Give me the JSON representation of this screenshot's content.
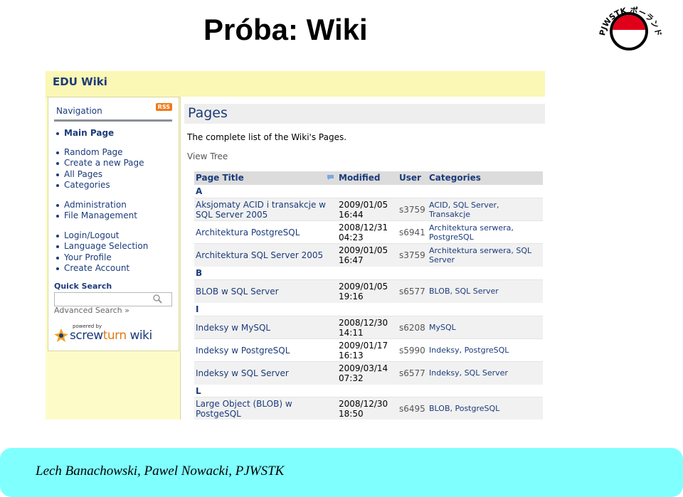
{
  "slide": {
    "title": "Próba: Wiki",
    "footer": "Lech Banachowski, Pawel Nowacki, PJWSTK"
  },
  "logo": {
    "text": "PJWSTK ポーランド日本情報工科大学",
    "colors": {
      "ring": "#000000",
      "disk": "#e0001a"
    }
  },
  "wiki": {
    "site_title": "EDU Wiki",
    "navigation": {
      "header": "Navigation",
      "rss_label": "RSS",
      "items": [
        {
          "label": "Main Page"
        },
        {
          "label": "Random Page"
        },
        {
          "label": "Create a new Page"
        },
        {
          "label": "All Pages"
        },
        {
          "label": "Categories"
        },
        {
          "label": "Administration"
        },
        {
          "label": "File Management"
        },
        {
          "label": "Login/Logout"
        },
        {
          "label": "Language Selection"
        },
        {
          "label": "Your Profile"
        },
        {
          "label": "Create Account"
        }
      ]
    },
    "quick_search": {
      "label": "Quick Search",
      "value": "",
      "advanced_link": "Advanced Search »"
    },
    "powered_by": {
      "small_text": "powered by",
      "brand_1": "screw",
      "brand_2": "turn",
      "brand_3": " wiki"
    },
    "pages": {
      "title": "Pages",
      "intro": "The complete list of the Wiki's Pages.",
      "view_tree": "View Tree",
      "columns": {
        "title": "Page Title",
        "modified": "Modified",
        "user": "User",
        "categories": "Categories"
      },
      "groups": [
        {
          "letter": "A",
          "rows": [
            {
              "title": "Aksjomaty ACID i transakcje w SQL Server 2005",
              "modified": "2009/01/05 16:44",
              "user": "s3759",
              "categories": "ACID, SQL Server, Transakcje"
            },
            {
              "title": "Architektura PostgreSQL",
              "modified": "2008/12/31 04:23",
              "user": "s6941",
              "categories": "Architektura serwera, PostgreSQL"
            },
            {
              "title": "Architektura SQL Server 2005",
              "modified": "2009/01/05 16:47",
              "user": "s3759",
              "categories": "Architektura serwera, SQL Server"
            }
          ]
        },
        {
          "letter": "B",
          "rows": [
            {
              "title": "BLOB w SQL Server",
              "modified": "2009/01/05 19:16",
              "user": "s6577",
              "categories": "BLOB, SQL Server"
            }
          ]
        },
        {
          "letter": "I",
          "rows": [
            {
              "title": "Indeksy w MySQL",
              "modified": "2008/12/30 14:11",
              "user": "s6208",
              "categories": "MySQL"
            },
            {
              "title": "Indeksy w PostgreSQL",
              "modified": "2009/01/17 16:13",
              "user": "s5990",
              "categories": "Indeksy, PostgreSQL"
            },
            {
              "title": "Indeksy w SQL Server",
              "modified": "2009/03/14 07:32",
              "user": "s6577",
              "categories": "Indeksy, SQL Server"
            }
          ]
        },
        {
          "letter": "L",
          "rows": [
            {
              "title": "Large Object (BLOB) w PostgeSQL",
              "modified": "2008/12/30 18:50",
              "user": "s6495",
              "categories": "BLOB, PostgreSQL"
            }
          ]
        }
      ]
    }
  }
}
